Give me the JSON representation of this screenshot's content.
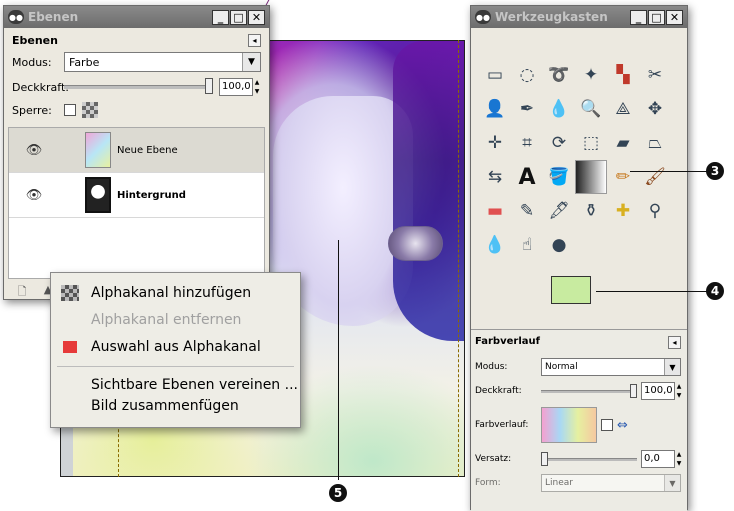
{
  "layers_window": {
    "title": "Ebenen",
    "section_title": "Ebenen",
    "mode_label": "Modus:",
    "mode_value": "Farbe",
    "opacity_label": "Deckkraft:",
    "opacity_value": "100,0",
    "lock_label": "Sperre:",
    "layers": [
      {
        "name": "Neue Ebene",
        "visible": true
      },
      {
        "name": "Hintergrund",
        "visible": true
      }
    ]
  },
  "context_menu": {
    "items": [
      {
        "label": "Alphakanal hinzufügen",
        "enabled": true,
        "icon": "alpha-checker-icon"
      },
      {
        "label": "Alphakanal entfernen",
        "enabled": false
      },
      {
        "label": "Auswahl aus Alphakanal",
        "enabled": true,
        "icon": "red-selection-icon"
      },
      {
        "label": "Sichtbare Ebenen vereinen ...",
        "enabled": true
      },
      {
        "label": "Bild zusammenfügen",
        "enabled": true
      }
    ]
  },
  "toolbox_window": {
    "title": "Werkzeugkasten",
    "foreground_color": "#c8eba0",
    "background_color": "#ffffff",
    "tool_options": {
      "title": "Farbverlauf",
      "mode_label": "Modus:",
      "mode_value": "Normal",
      "opacity_label": "Deckkraft:",
      "opacity_value": "100,0",
      "gradient_label": "Farbverlauf:",
      "offset_label": "Versatz:",
      "offset_value": "0,0",
      "shape_label": "Form:",
      "shape_value": "Linear"
    }
  },
  "callouts": [
    "3",
    "4",
    "5"
  ]
}
